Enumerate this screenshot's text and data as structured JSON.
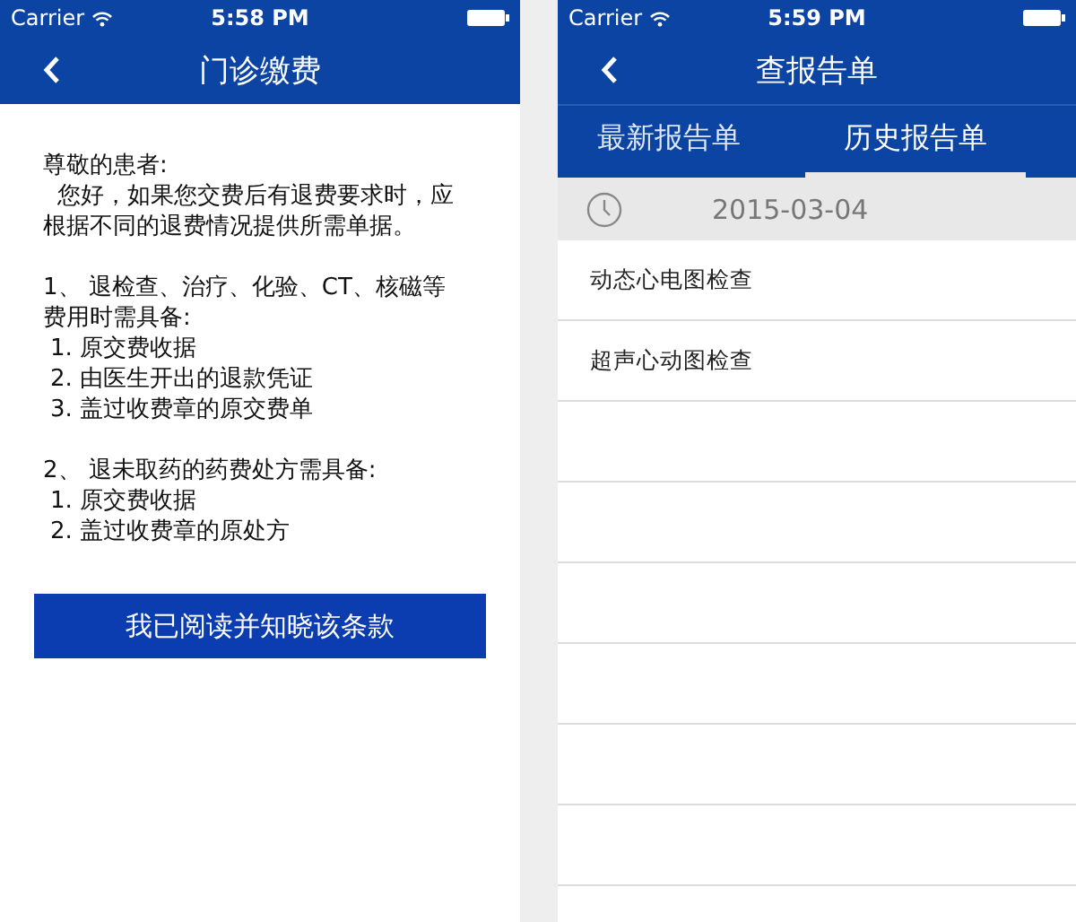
{
  "left_screen": {
    "status_bar": {
      "carrier": "Carrier",
      "time": "5:58 PM"
    },
    "nav": {
      "title": "门诊缴费"
    },
    "notice": [
      {
        "kind": "salutation",
        "text": "尊敬的患者:"
      },
      {
        "kind": "para",
        "text": "您好，如果您交费后有退费要求时，应根据不同的退费情况提供所需单据。"
      },
      {
        "kind": "heading",
        "text": "1、 退检查、治疗、化验、CT、核磁等费用时需具备:"
      },
      {
        "kind": "item",
        "text": "1. 原交费收据"
      },
      {
        "kind": "item",
        "text": "2. 由医生开出的退款凭证"
      },
      {
        "kind": "item",
        "text": "3. 盖过收费章的原交费单"
      },
      {
        "kind": "heading",
        "text": "2、 退未取药的药费处方需具备:"
      },
      {
        "kind": "item",
        "text": "1. 原交费收据"
      },
      {
        "kind": "item",
        "text": "2. 盖过收费章的原处方"
      }
    ],
    "confirm_button": "我已阅读并知晓该条款"
  },
  "right_screen": {
    "status_bar": {
      "carrier": "Carrier",
      "time": "5:59 PM"
    },
    "nav": {
      "title": "查报告单"
    },
    "tabs": [
      {
        "label": "最新报告单",
        "selected": false
      },
      {
        "label": "历史报告单",
        "selected": true
      }
    ],
    "date": "2015-03-04",
    "reports": [
      "动态心电图检查",
      "超声心动图检查"
    ]
  }
}
